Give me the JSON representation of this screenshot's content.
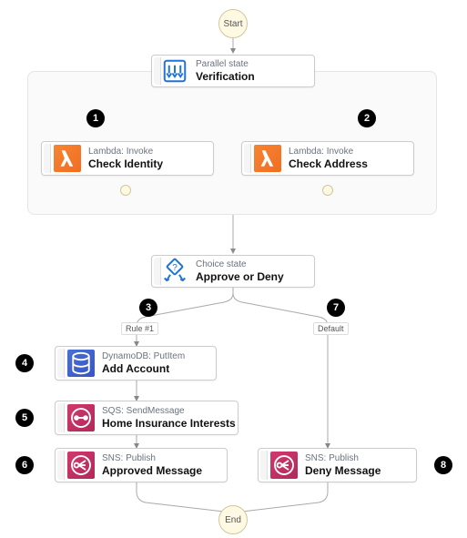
{
  "terminals": {
    "start": "Start",
    "end": "End"
  },
  "parallel": {
    "sub": "Parallel state",
    "main": "Verification"
  },
  "choice": {
    "sub": "Choice state",
    "main": "Approve or Deny"
  },
  "rules": {
    "r1": "Rule #1",
    "default": "Default"
  },
  "nodes": {
    "check_identity": {
      "sub": "Lambda: Invoke",
      "main": "Check Identity"
    },
    "check_address": {
      "sub": "Lambda: Invoke",
      "main": "Check Address"
    },
    "add_account": {
      "sub": "DynamoDB: PutItem",
      "main": "Add Account"
    },
    "home_insurance": {
      "sub": "SQS: SendMessage",
      "main": "Home Insurance Interests"
    },
    "approved_msg": {
      "sub": "SNS: Publish",
      "main": "Approved Message"
    },
    "deny_msg": {
      "sub": "SNS: Publish",
      "main": "Deny Message"
    }
  },
  "badges": {
    "b1": "1",
    "b2": "2",
    "b3": "3",
    "b4": "4",
    "b5": "5",
    "b6": "6",
    "b7": "7",
    "b8": "8"
  },
  "chart_data": {
    "type": "table",
    "title": "AWS Step Functions Workflow",
    "workflow": {
      "start": "Start",
      "states": [
        {
          "id": 0,
          "name": "Verification",
          "type": "Parallel",
          "branches": [
            {
              "id": 1,
              "name": "Check Identity",
              "service": "Lambda",
              "action": "Invoke"
            },
            {
              "id": 2,
              "name": "Check Address",
              "service": "Lambda",
              "action": "Invoke"
            }
          ]
        },
        {
          "name": "Approve or Deny",
          "type": "Choice",
          "rules": [
            {
              "label": "Rule #1",
              "id": 3,
              "next": [
                {
                  "id": 4,
                  "name": "Add Account",
                  "service": "DynamoDB",
                  "action": "PutItem"
                },
                {
                  "id": 5,
                  "name": "Home Insurance Interests",
                  "service": "SQS",
                  "action": "SendMessage"
                },
                {
                  "id": 6,
                  "name": "Approved Message",
                  "service": "SNS",
                  "action": "Publish"
                }
              ]
            },
            {
              "label": "Default",
              "id": 7,
              "next": [
                {
                  "id": 8,
                  "name": "Deny Message",
                  "service": "SNS",
                  "action": "Publish"
                }
              ]
            }
          ]
        }
      ],
      "end": "End"
    }
  }
}
